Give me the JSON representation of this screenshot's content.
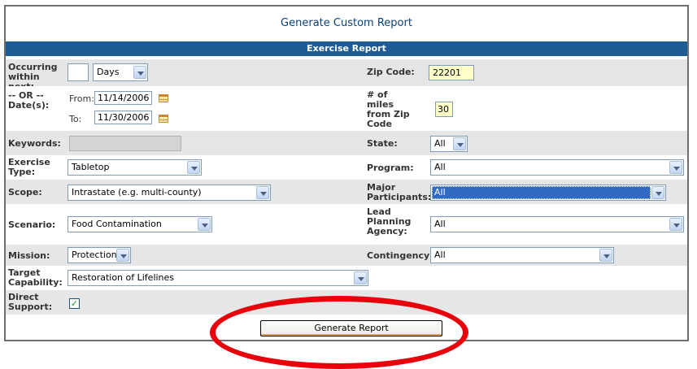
{
  "title": "Generate Custom Report",
  "section_header": "Exercise Report",
  "occurring": {
    "label": "Occurring within next:",
    "value": "",
    "unit": "Days"
  },
  "dates": {
    "label": "-- OR -- Date(s):",
    "from_label": "From:",
    "from_value": "11/14/2006",
    "to_label": "To:",
    "to_value": "11/30/2006"
  },
  "zip": {
    "label": "Zip Code:",
    "value": "22201"
  },
  "miles": {
    "label": "# of miles from Zip Code",
    "value": "30"
  },
  "keywords": {
    "label": "Keywords:",
    "value": ""
  },
  "state": {
    "label": "State:",
    "value": "All"
  },
  "exercise_type": {
    "label": "Exercise Type:",
    "value": "Tabletop"
  },
  "program": {
    "label": "Program:",
    "value": "All"
  },
  "scope": {
    "label": "Scope:",
    "value": "Intrastate (e.g. multi-county)"
  },
  "major_participants": {
    "label": "Major Participants:",
    "value": "All"
  },
  "scenario": {
    "label": "Scenario:",
    "value": "Food Contamination"
  },
  "lead_agency": {
    "label": "Lead Planning Agency:",
    "value": "All"
  },
  "mission": {
    "label": "Mission:",
    "value": "Protection"
  },
  "contingency": {
    "label": "Contingency:",
    "value": "All"
  },
  "target_capability": {
    "label": "Target Capability:",
    "value": "Restoration of Lifelines"
  },
  "direct_support": {
    "label": "Direct Support:",
    "checked": true
  },
  "generate_button": "Generate Report",
  "colors": {
    "header_bg": "#1f5b95",
    "title_text": "#0b3f7a",
    "highlight_circle": "#e8000a",
    "required_field_bg": "#ffffc8"
  }
}
